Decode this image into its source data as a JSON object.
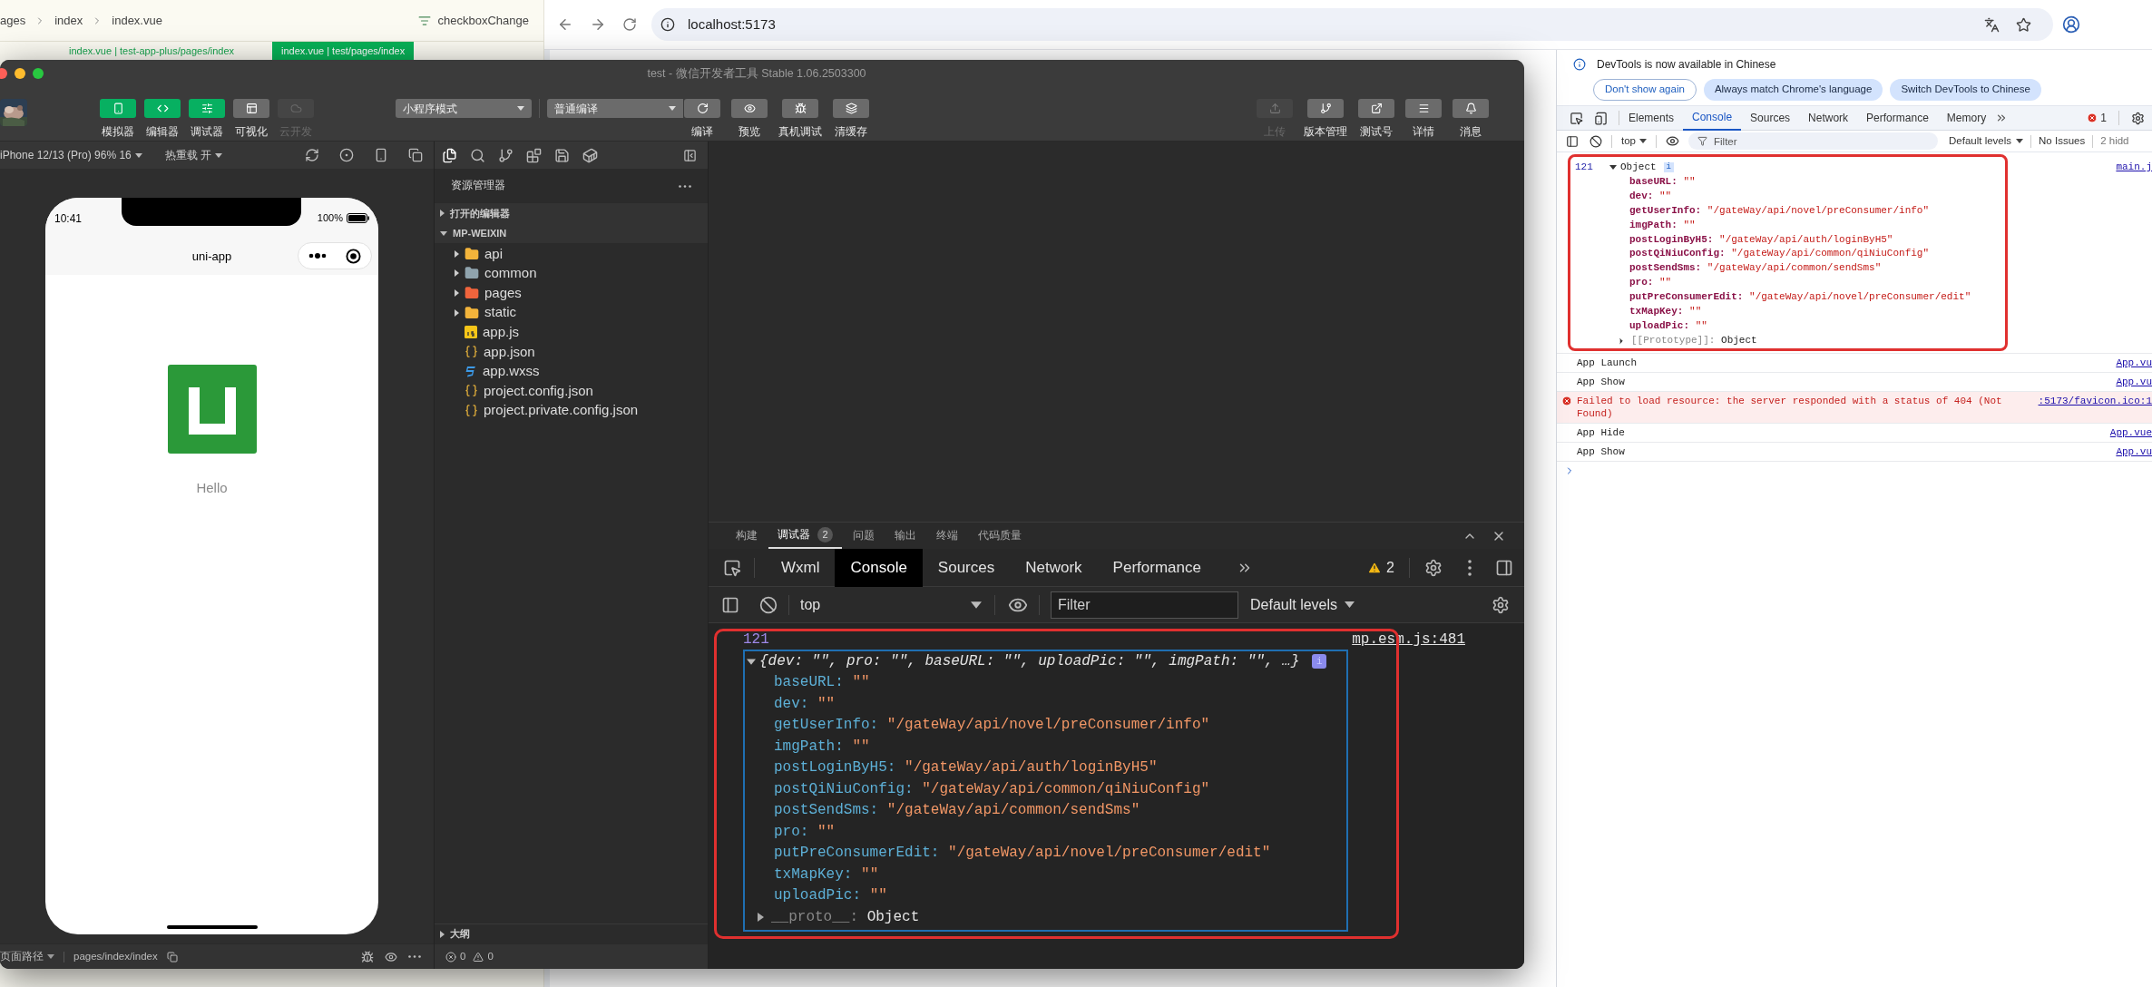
{
  "editor": {
    "breadcrumb": [
      "ages",
      "index",
      "index.vue"
    ],
    "symbol": "checkboxChange",
    "tabs": [
      {
        "label": "index.vue | test-app-plus/pages/index",
        "selected": false
      },
      {
        "label": "index.vue | test/pages/index",
        "selected": true
      }
    ]
  },
  "browser": {
    "url": "localhost:5173",
    "devtools": {
      "notice": "DevTools is now available in Chinese",
      "notice_buttons": [
        {
          "label": "Don't show again",
          "kind": "outline"
        },
        {
          "label": "Always match Chrome's language",
          "kind": "filled"
        },
        {
          "label": "Switch DevTools to Chinese",
          "kind": "filled"
        }
      ],
      "tabs": [
        {
          "label": "Elements",
          "selected": false
        },
        {
          "label": "Console",
          "selected": true
        },
        {
          "label": "Sources",
          "selected": false
        },
        {
          "label": "Network",
          "selected": false
        },
        {
          "label": "Performance",
          "selected": false
        },
        {
          "label": "Memory",
          "selected": false
        }
      ],
      "errors": "1",
      "context": "top",
      "filter_placeholder": "Filter",
      "levels": "Default levels",
      "issues": "No Issues",
      "hidden": "2 hidd",
      "log": {
        "line": "121",
        "label": "Object",
        "info_badge": "i",
        "source": "main.j",
        "properties": [
          {
            "key": "baseURL:",
            "value": "\"\""
          },
          {
            "key": "dev:",
            "value": "\"\""
          },
          {
            "key": "getUserInfo:",
            "value": "\"/gateWay/api/novel/preConsumer/info\""
          },
          {
            "key": "imgPath:",
            "value": "\"\""
          },
          {
            "key": "postLoginByH5:",
            "value": "\"/gateWay/api/auth/loginByH5\""
          },
          {
            "key": "postQiNiuConfig:",
            "value": "\"/gateWay/api/common/qiNiuConfig\""
          },
          {
            "key": "postSendSms:",
            "value": "\"/gateWay/api/common/sendSms\""
          },
          {
            "key": "pro:",
            "value": "\"\""
          },
          {
            "key": "putPreConsumerEdit:",
            "value": "\"/gateWay/api/novel/preConsumer/edit\""
          },
          {
            "key": "txMapKey:",
            "value": "\"\""
          },
          {
            "key": "uploadPic:",
            "value": "\"\""
          }
        ],
        "prototype": {
          "key": "[[Prototype]]:",
          "value": "Object"
        }
      },
      "messages": [
        {
          "text": "App Launch",
          "source": "App.vu",
          "kind": "log"
        },
        {
          "text": "App Show",
          "source": "App.vu",
          "kind": "log"
        },
        {
          "text": "Failed to load resource: the server responded with a status of 404 (Not Found)",
          "source": ":5173/favicon.ico:1",
          "kind": "error"
        },
        {
          "text": "App Hide",
          "source": "App.vue",
          "kind": "log"
        },
        {
          "text": "App Show",
          "source": "App.vu",
          "kind": "log"
        }
      ]
    }
  },
  "wechat": {
    "title": "test - 微信开发者工具 Stable 1.06.2503300",
    "left_tools": [
      {
        "label": "模拟器",
        "on": true,
        "disabled": false
      },
      {
        "label": "编辑器",
        "on": true,
        "disabled": false
      },
      {
        "label": "调试器",
        "on": true,
        "disabled": false
      },
      {
        "label": "可视化",
        "on": false,
        "disabled": false
      },
      {
        "label": "云开发",
        "on": false,
        "disabled": true
      }
    ],
    "mode": "小程序模式",
    "compile_mode": "普通编译",
    "mid_tools": [
      {
        "label": "编译",
        "disabled": false
      },
      {
        "label": "预览",
        "disabled": false
      },
      {
        "label": "真机调试",
        "disabled": false
      },
      {
        "label": "清缓存",
        "disabled": false
      }
    ],
    "right_tools": [
      {
        "label": "上传",
        "disabled": true
      },
      {
        "label": "版本管理",
        "disabled": false
      },
      {
        "label": "测试号",
        "disabled": false
      },
      {
        "label": "详情",
        "disabled": false
      },
      {
        "label": "消息",
        "disabled": false
      }
    ],
    "simulator": {
      "device": "iPhone 12/13 (Pro) 96% 16",
      "hot_reload": "热重载 开",
      "time": "10:41",
      "battery": "100%",
      "nav_title": "uni-app",
      "page_text": "Hello",
      "page_path_label": "页面路径",
      "page_path": "pages/index/index"
    },
    "explorer": {
      "title": "资源管理器",
      "sections": [
        {
          "label": "打开的编辑器",
          "expanded": false
        },
        {
          "label": "MP-WEIXIN",
          "expanded": true
        }
      ],
      "tree": [
        {
          "name": "api",
          "kind": "folder",
          "color": "#f3b43b"
        },
        {
          "name": "common",
          "kind": "folder",
          "color": "#90a4ae"
        },
        {
          "name": "pages",
          "kind": "folder",
          "color": "#f0643c"
        },
        {
          "name": "static",
          "kind": "folder",
          "color": "#f3b43b"
        },
        {
          "name": "app.js",
          "kind": "js"
        },
        {
          "name": "app.json",
          "kind": "json"
        },
        {
          "name": "app.wxss",
          "kind": "css"
        },
        {
          "name": "project.config.json",
          "kind": "json"
        },
        {
          "name": "project.private.config.json",
          "kind": "json"
        }
      ],
      "outline": "大纲",
      "errors": "0",
      "warnings": "0"
    },
    "debugger": {
      "panel_tabs": [
        {
          "label": "构建",
          "selected": false
        },
        {
          "label": "调试器",
          "selected": true,
          "badge": "2"
        },
        {
          "label": "问题",
          "selected": false
        },
        {
          "label": "输出",
          "selected": false
        },
        {
          "label": "终端",
          "selected": false
        },
        {
          "label": "代码质量",
          "selected": false
        }
      ],
      "tabs": [
        {
          "label": "Wxml",
          "selected": false
        },
        {
          "label": "Console",
          "selected": true
        },
        {
          "label": "Sources",
          "selected": false
        },
        {
          "label": "Network",
          "selected": false
        },
        {
          "label": "Performance",
          "selected": false
        }
      ],
      "warnings": "2",
      "context": "top",
      "filter_placeholder": "Filter",
      "levels": "Default levels",
      "log": {
        "line": "121",
        "source": "mp.esm.js:481",
        "summary": "{dev: \"\", pro: \"\", baseURL: \"\", uploadPic: \"\", imgPath: \"\", …}",
        "info_badge": "i",
        "properties": [
          {
            "key": "baseURL:",
            "value": "\"\""
          },
          {
            "key": "dev:",
            "value": "\"\""
          },
          {
            "key": "getUserInfo:",
            "value": "\"/gateWay/api/novel/preConsumer/info\""
          },
          {
            "key": "imgPath:",
            "value": "\"\""
          },
          {
            "key": "postLoginByH5:",
            "value": "\"/gateWay/api/auth/loginByH5\""
          },
          {
            "key": "postQiNiuConfig:",
            "value": "\"/gateWay/api/common/qiNiuConfig\""
          },
          {
            "key": "postSendSms:",
            "value": "\"/gateWay/api/common/sendSms\""
          },
          {
            "key": "pro:",
            "value": "\"\""
          },
          {
            "key": "putPreConsumerEdit:",
            "value": "\"/gateWay/api/novel/preConsumer/edit\""
          },
          {
            "key": "txMapKey:",
            "value": "\"\""
          },
          {
            "key": "uploadPic:",
            "value": "\"\""
          }
        ],
        "proto": {
          "key": "__proto__:",
          "value": "Object"
        }
      }
    }
  }
}
